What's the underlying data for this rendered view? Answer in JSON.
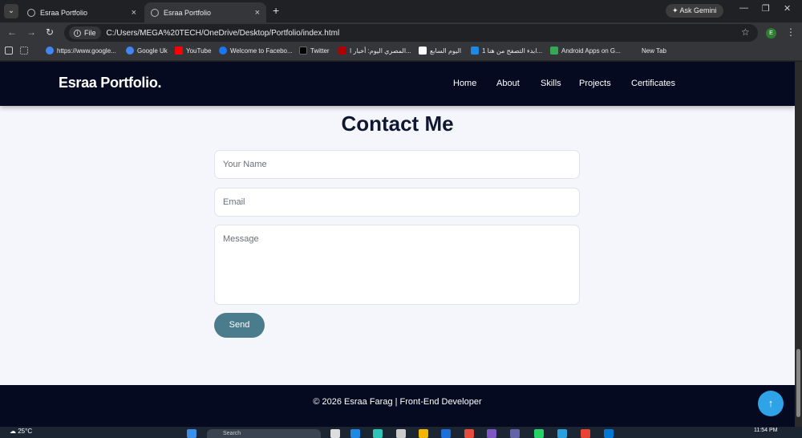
{
  "browser": {
    "tabs": [
      {
        "title": "Esraa Portfolio"
      },
      {
        "title": "Esraa Portfolio"
      }
    ],
    "ask_gemini": "Ask Gemini",
    "file_chip": "File",
    "url": "C:/Users/MEGA%20TECH/OneDrive/Desktop/Portfolio/index.html",
    "profile_initial": "E",
    "bookmarks": [
      {
        "label": "https://www.google...",
        "color": "#4285f4"
      },
      {
        "label": "Google Uk",
        "color": "#4285f4"
      },
      {
        "label": "YouTube",
        "color": "#ff0000"
      },
      {
        "label": "Welcome to Facebo...",
        "color": "#1877f2"
      },
      {
        "label": "Twitter",
        "color": "#000000"
      },
      {
        "label": "المصري اليوم: أخبار ا...",
        "color": "#b00000"
      },
      {
        "label": "اليوم السابع",
        "color": "#ffffff"
      },
      {
        "label": "ابدء التصفح من هنا 1...",
        "color": "#1e88e5"
      },
      {
        "label": "Android Apps on G...",
        "color": "#34a853"
      },
      {
        "label": "New Tab",
        "color": "#35363a"
      }
    ]
  },
  "site": {
    "logo": "Esraa Portfolio.",
    "nav": [
      "Home",
      "About",
      "Skills",
      "Projects",
      "Certificates"
    ],
    "contact": {
      "title": "Contact Me",
      "name_placeholder": "Your Name",
      "email_placeholder": "Email",
      "message_placeholder": "Message",
      "send_label": "Send"
    },
    "footer": "© 2026 Esraa Farag | Front-End Developer",
    "to_top_icon": "arrow-up-icon"
  },
  "taskbar": {
    "weather": "25°C",
    "search": "Search",
    "time": "11:54 PM"
  }
}
